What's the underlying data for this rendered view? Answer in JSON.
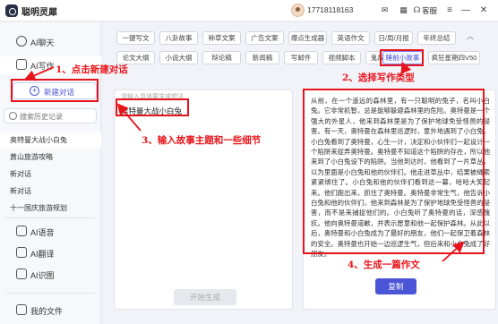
{
  "app": {
    "title": "聪明灵犀"
  },
  "topbar": {
    "phone": "17718118163",
    "kefu_label": "客服"
  },
  "sidebar": {
    "nav": [
      {
        "label": "AI聊天"
      },
      {
        "label": "AI写作"
      }
    ],
    "new_chat_label": "新建对话",
    "history_search_placeholder": "搜索历史记录",
    "history": [
      "奥特曼大战小白兔",
      "黄山旅游攻略",
      "新对话",
      "新对话",
      "十一国庆旅游规划"
    ],
    "tools": [
      {
        "label": "AI语音"
      },
      {
        "label": "AI翻译"
      },
      {
        "label": "AI识图"
      }
    ],
    "files_label": "我的文件"
  },
  "writing_types": {
    "row1": [
      "一键写文",
      "八卦故事",
      "种草文案",
      "广告文案",
      "爆点生成器",
      "英语作文",
      "日/周/月报",
      "年终总结"
    ],
    "row2": [
      "论文大纲",
      "小说大纲",
      "辩论稿",
      "新闻稿",
      "写邮件",
      "视频脚本",
      "鬼故事",
      "睡前小故事",
      "疯狂星期四V50"
    ],
    "selected": "睡前小故事"
  },
  "input": {
    "placeholder": "请输入具体要求或想法",
    "value": "奥特曼大战小白兔"
  },
  "buttons": {
    "generate": "开始生成",
    "copy": "复制"
  },
  "output": {
    "story": "从前，在一个遥远的森林里，有一只聪明的兔子，名叫小白兔。它非常机智，总是能够躲避森林里的危险。奥特曼是一个强大的外星人，他来到森林里是为了保护地球免受怪兽的侵害。有一天，奥特曼在森林里巡逻时，意外地遇到了小白兔。小白兔看到了奥特曼，心生一计，决定和小伙伴们一起设计一个陷阱来捉弄奥特曼。奥特曼不知道这个陷阱的存在，所以他来到了小白兔设下的陷阱。当他到达时，他看到了一片草丛，以为里面是小白兔和他的伙伴们。他走进草丛中，结果被绳索紧紧绑住了。小白兔和他的伙伴们看到这一幕，哈哈大笑起来。他们跑出来，抓住了奥特曼。奥特曼非常生气，他告诉小白兔和他的伙伴们，他来到森林是为了保护地球免受怪兽的侵害，而不是来捕捉他们的。小白兔听了奥特曼的话，深感愧疚。他向奥特曼道歉，并表示愿意和他一起保护森林。从此以后，奥特曼和小白兔成为了最好的朋友，他们一起保卫着森林的安全。奥特曼也开始一边巡逻生气，但后来和小白兔成了好朋友。"
  },
  "annotations": {
    "step1": "1、点击新建对话",
    "step2": "2、选择写作类型",
    "step3": "3、输入故事主题和一些细节",
    "step4": "4、生成一篇作文"
  },
  "colors": {
    "accent": "#4b55d8",
    "annotation": "#e8141b"
  }
}
